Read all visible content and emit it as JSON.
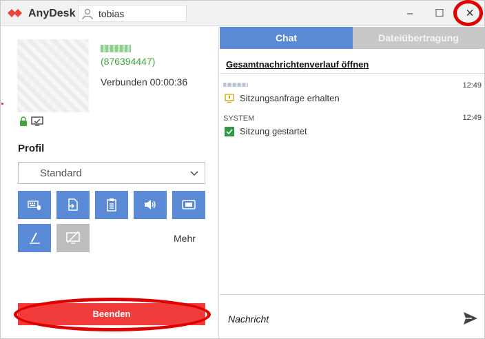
{
  "titlebar": {
    "app_name": "AnyDesk",
    "user_field": "tobias",
    "minimize": "–",
    "maximize": "☐",
    "close": "✕"
  },
  "session": {
    "remote_id": "(876394447)",
    "status": "Verbunden 00:00:36"
  },
  "profile": {
    "title": "Profil",
    "selected": "Standard"
  },
  "tools": {
    "more_label": "Mehr"
  },
  "end_button": "Beenden",
  "tabs": {
    "chat": "Chat",
    "transfer": "Dateiübertragung"
  },
  "chat": {
    "history_link": "Gesamtnachrichtenverlauf öffnen",
    "messages": [
      {
        "sender": "",
        "time": "12:49",
        "text": "Sitzungsanfrage erhalten"
      },
      {
        "sender": "SYSTEM",
        "time": "12:49",
        "text": "Sitzung gestartet"
      }
    ],
    "input_placeholder": "Nachricht"
  },
  "colors": {
    "accent_blue": "#5a89d6",
    "end_red": "#f23c3c",
    "annotation_red": "#e00000",
    "id_green": "#3aa53a"
  },
  "icons": [
    "anydesk-logo-icon",
    "user-icon",
    "lock-icon",
    "monitor-icon",
    "chevron-down-icon",
    "keyboard-mouse-icon",
    "file-transfer-icon",
    "clipboard-icon",
    "audio-icon",
    "video-icon",
    "draw-icon",
    "screen-blank-icon",
    "session-request-icon",
    "check-icon",
    "send-icon"
  ]
}
